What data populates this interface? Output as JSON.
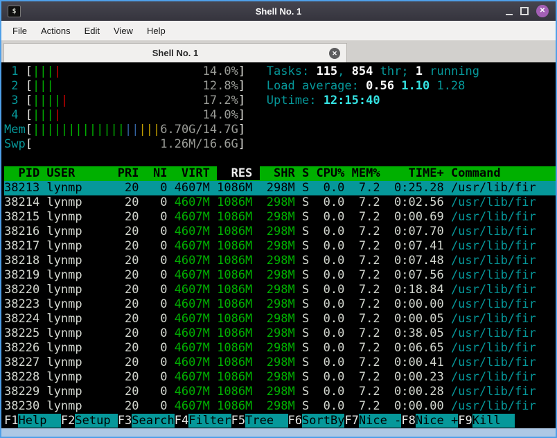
{
  "window": {
    "title": "Shell No. 1",
    "icon_glyph": "$",
    "controls": {
      "close_glyph": "✕"
    }
  },
  "menubar": {
    "items": [
      {
        "label": "File"
      },
      {
        "label": "Actions"
      },
      {
        "label": "Edit"
      },
      {
        "label": "View"
      },
      {
        "label": "Help"
      }
    ]
  },
  "tabbar": {
    "active_tab": {
      "label": "Shell No. 1",
      "close_glyph": "✕"
    }
  },
  "terminal": {
    "meters": [
      {
        "type": "cpu",
        "label": "1",
        "bars": [
          {
            "t": "|||",
            "c": "green"
          },
          {
            "t": "|",
            "c": "red"
          }
        ],
        "value": "14.0%"
      },
      {
        "type": "cpu",
        "label": "2",
        "bars": [
          {
            "t": "|||",
            "c": "green"
          }
        ],
        "value": "12.8%"
      },
      {
        "type": "cpu",
        "label": "3",
        "bars": [
          {
            "t": "||||",
            "c": "green"
          },
          {
            "t": "|",
            "c": "red"
          }
        ],
        "value": "17.2%"
      },
      {
        "type": "cpu",
        "label": "4",
        "bars": [
          {
            "t": "|||",
            "c": "green"
          },
          {
            "t": "|",
            "c": "red"
          }
        ],
        "value": "14.0%"
      },
      {
        "type": "mem",
        "label": "Mem",
        "bars": [
          {
            "t": "|||||||||||||",
            "c": "green"
          },
          {
            "t": "||",
            "c": "blue"
          },
          {
            "t": "|||",
            "c": "yellow"
          }
        ],
        "value": "6.70G/14.7G"
      },
      {
        "type": "swp",
        "label": "Swp",
        "bars": [],
        "value": "1.26M/16.6G"
      }
    ],
    "info_lines": [
      {
        "name": "tasks-summary",
        "segments": [
          {
            "t": "Tasks: ",
            "c": "cyan"
          },
          {
            "t": "115",
            "c": "bw"
          },
          {
            "t": ", ",
            "c": "cyan"
          },
          {
            "t": "854",
            "c": "bw"
          },
          {
            "t": " thr; ",
            "c": "cyan"
          },
          {
            "t": "1",
            "c": "bw"
          },
          {
            "t": " running",
            "c": "cyan"
          }
        ]
      },
      {
        "name": "load-average",
        "segments": [
          {
            "t": "Load average: ",
            "c": "cyan"
          },
          {
            "t": "0.56 ",
            "c": "bw"
          },
          {
            "t": "1.10 ",
            "c": "bc"
          },
          {
            "t": "1.28",
            "c": "cyan"
          }
        ]
      },
      {
        "name": "uptime",
        "segments": [
          {
            "t": "Uptime: ",
            "c": "cyan"
          },
          {
            "t": "12:15:40",
            "c": "bc"
          }
        ]
      }
    ],
    "table": {
      "columns": [
        "PID",
        "USER",
        "PRI",
        "NI",
        "VIRT",
        "RES",
        "SHR",
        "S",
        "CPU%",
        "MEM%",
        "TIME+",
        "Command"
      ],
      "sort_column": "RES",
      "selected_pid": "38213",
      "rows": [
        [
          "38213",
          "lynmp",
          "20",
          "0",
          "4607M",
          "1086M",
          "298M",
          "S",
          "0.0",
          "7.2",
          "0:25.28",
          "/usr/lib/fir"
        ],
        [
          "38214",
          "lynmp",
          "20",
          "0",
          "4607M",
          "1086M",
          "298M",
          "S",
          "0.0",
          "7.2",
          "0:02.56",
          "/usr/lib/fir"
        ],
        [
          "38215",
          "lynmp",
          "20",
          "0",
          "4607M",
          "1086M",
          "298M",
          "S",
          "0.0",
          "7.2",
          "0:00.69",
          "/usr/lib/fir"
        ],
        [
          "38216",
          "lynmp",
          "20",
          "0",
          "4607M",
          "1086M",
          "298M",
          "S",
          "0.0",
          "7.2",
          "0:07.70",
          "/usr/lib/fir"
        ],
        [
          "38217",
          "lynmp",
          "20",
          "0",
          "4607M",
          "1086M",
          "298M",
          "S",
          "0.0",
          "7.2",
          "0:07.41",
          "/usr/lib/fir"
        ],
        [
          "38218",
          "lynmp",
          "20",
          "0",
          "4607M",
          "1086M",
          "298M",
          "S",
          "0.0",
          "7.2",
          "0:07.48",
          "/usr/lib/fir"
        ],
        [
          "38219",
          "lynmp",
          "20",
          "0",
          "4607M",
          "1086M",
          "298M",
          "S",
          "0.0",
          "7.2",
          "0:07.56",
          "/usr/lib/fir"
        ],
        [
          "38220",
          "lynmp",
          "20",
          "0",
          "4607M",
          "1086M",
          "298M",
          "S",
          "0.0",
          "7.2",
          "0:18.84",
          "/usr/lib/fir"
        ],
        [
          "38223",
          "lynmp",
          "20",
          "0",
          "4607M",
          "1086M",
          "298M",
          "S",
          "0.0",
          "7.2",
          "0:00.00",
          "/usr/lib/fir"
        ],
        [
          "38224",
          "lynmp",
          "20",
          "0",
          "4607M",
          "1086M",
          "298M",
          "S",
          "0.0",
          "7.2",
          "0:00.05",
          "/usr/lib/fir"
        ],
        [
          "38225",
          "lynmp",
          "20",
          "0",
          "4607M",
          "1086M",
          "298M",
          "S",
          "0.0",
          "7.2",
          "0:38.05",
          "/usr/lib/fir"
        ],
        [
          "38226",
          "lynmp",
          "20",
          "0",
          "4607M",
          "1086M",
          "298M",
          "S",
          "0.0",
          "7.2",
          "0:06.65",
          "/usr/lib/fir"
        ],
        [
          "38227",
          "lynmp",
          "20",
          "0",
          "4607M",
          "1086M",
          "298M",
          "S",
          "0.0",
          "7.2",
          "0:00.41",
          "/usr/lib/fir"
        ],
        [
          "38228",
          "lynmp",
          "20",
          "0",
          "4607M",
          "1086M",
          "298M",
          "S",
          "0.0",
          "7.2",
          "0:00.23",
          "/usr/lib/fir"
        ],
        [
          "38229",
          "lynmp",
          "20",
          "0",
          "4607M",
          "1086M",
          "298M",
          "S",
          "0.0",
          "7.2",
          "0:00.28",
          "/usr/lib/fir"
        ],
        [
          "38230",
          "lynmp",
          "20",
          "0",
          "4607M",
          "1086M",
          "298M",
          "S",
          "0.0",
          "7.2",
          "0:00.00",
          "/usr/lib/fir"
        ]
      ]
    },
    "fkeys": [
      {
        "key": "F1",
        "label": "Help"
      },
      {
        "key": "F2",
        "label": "Setup"
      },
      {
        "key": "F3",
        "label": "Search"
      },
      {
        "key": "F4",
        "label": "Filter"
      },
      {
        "key": "F5",
        "label": "Tree"
      },
      {
        "key": "F6",
        "label": "SortBy"
      },
      {
        "key": "F7",
        "label": "Nice -"
      },
      {
        "key": "F8",
        "label": "Nice +"
      },
      {
        "key": "F9",
        "label": "Kill"
      }
    ]
  },
  "colors": {
    "header_bg": "#00b000",
    "selection_bg": "#06989a",
    "terminal_bg": "#000000",
    "accent_border": "#4f9fe8",
    "titlebar_bg": "#3a3942",
    "close_button": "#a35fb5"
  }
}
